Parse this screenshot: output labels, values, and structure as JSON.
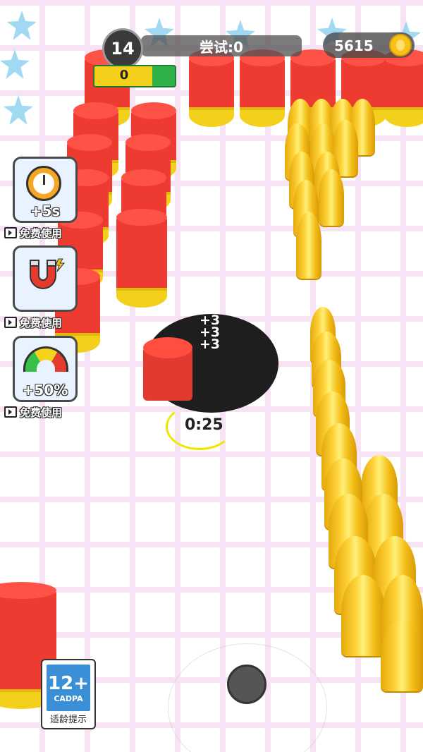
{
  "hud": {
    "level": "14",
    "attempt_label": "尝试:0",
    "progress_value": "0",
    "progress_fraction": 0.72,
    "coins": "5615"
  },
  "boosters": [
    {
      "label": "+5s",
      "free_label": "免费使用",
      "icon": "stopwatch-icon"
    },
    {
      "label": "",
      "free_label": "免费使用",
      "icon": "magnet-icon"
    },
    {
      "label": "+50%",
      "free_label": "免费使用",
      "icon": "speedometer-icon"
    }
  ],
  "hole": {
    "score_popups": [
      "+3",
      "+3",
      "+3"
    ],
    "timer": "0:25"
  },
  "age_rating": {
    "number": "12+",
    "org": "CADPA",
    "caption": "适龄提示"
  },
  "colors": {
    "canister_red": "#ee3b32",
    "canister_yellow": "#f3d01b",
    "bullet_gold": "#ffd43b",
    "hole_black": "#1e1e1e",
    "progress_green": "#2fb24a"
  }
}
